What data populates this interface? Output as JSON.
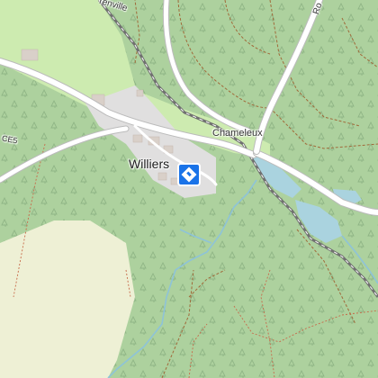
{
  "map": {
    "place_label": "Williers",
    "hamlet_label": "Chameleux",
    "road_ref_label": "CE5",
    "road_top_label": "renville",
    "road_right_label": "Ro",
    "colors": {
      "forest": "#add19e",
      "meadow": "#cdebb0",
      "farmland": "#eef0d5",
      "residential": "#e0dfdf",
      "building": "#d9d0c9",
      "road": "#ffffff",
      "road_casing": "#bbbbbb",
      "water": "#aad3df",
      "stream": "#8ec3d8",
      "railway": "#707070",
      "track": "#a06a3a",
      "path": "#c76a4a",
      "poi_marker": "#1a73e8"
    },
    "poi_icon": "directions-sign-icon"
  }
}
